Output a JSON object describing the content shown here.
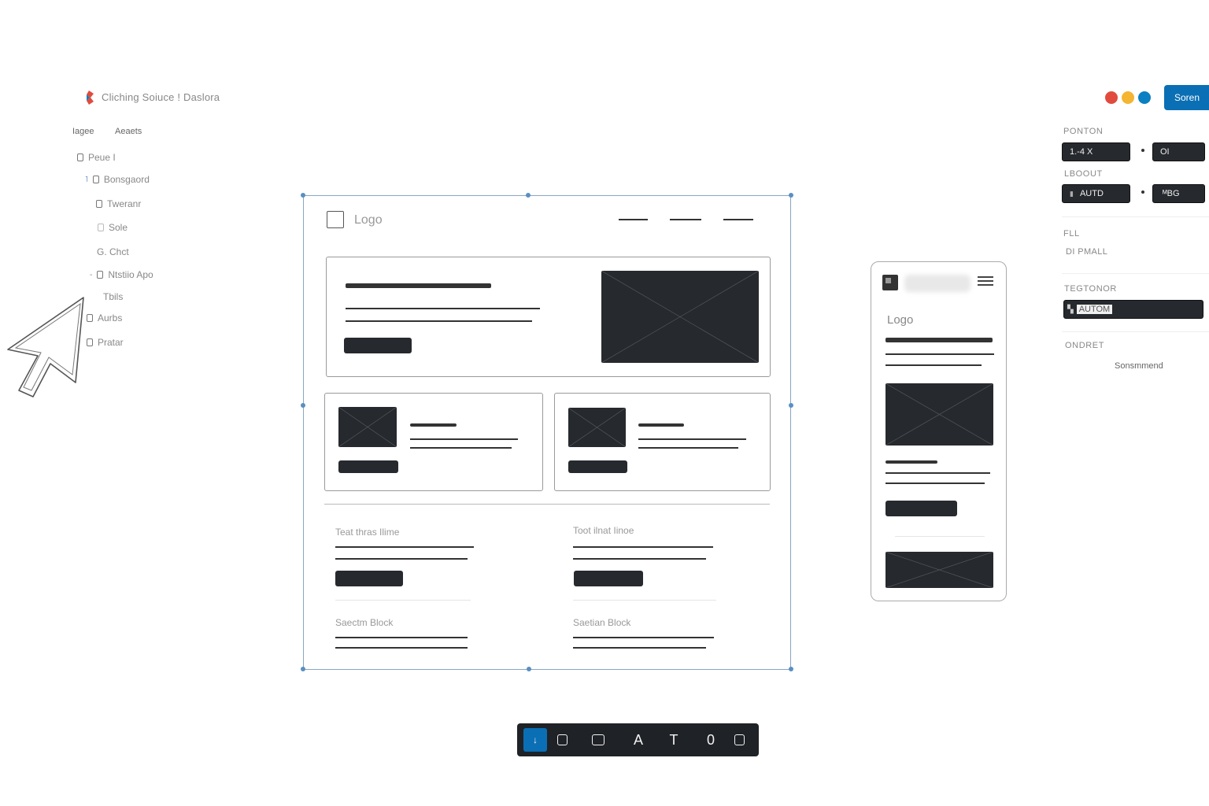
{
  "app": {
    "title": "Cliching Soiuce ! Daslora",
    "share_label": "Soren"
  },
  "colors": {
    "accent": "#0a6fb4",
    "traffic_red": "#e14b3d",
    "traffic_yellow": "#f5b431",
    "traffic_blue": "#0a7fc2",
    "wireframe_fill": "#26292d",
    "selection": "#5a8fc2"
  },
  "sidebar": {
    "tabs": [
      "Iagee",
      "Aeaets"
    ],
    "layers": [
      {
        "label": "Peue I",
        "icon": "frame-icon"
      },
      {
        "label": "Bonsgaord",
        "icon": "frame-icon"
      },
      {
        "label": "Tweranr",
        "icon": "frame-icon"
      },
      {
        "label": "Sole",
        "icon": "frame-icon"
      },
      {
        "label": "G. Chct",
        "icon": "none"
      },
      {
        "label": "Ntstiio Apo",
        "icon": "frame-icon"
      },
      {
        "label": "Tbils",
        "icon": "none"
      },
      {
        "label": "Aurbs",
        "icon": "frame-icon"
      },
      {
        "label": "Pratar",
        "icon": "frame-icon"
      }
    ]
  },
  "canvas": {
    "desktop": {
      "logo_text": "Logo",
      "text_block_1": "Teat thras Ilime",
      "text_block_2": "Toot ilnat Iinoe",
      "section_1": "Saectm Block",
      "section_2": "Saetian Block"
    },
    "mobile": {
      "logo_text": "Logo"
    }
  },
  "properties": {
    "position_label": "PONTON",
    "position_x": "1.-4 X",
    "position_y": "OI",
    "layout_label": "LBOOUT",
    "layout_value": "AUTD",
    "layout_secondary": "ᴹBG",
    "fill_label": "FLL",
    "fill_value": "DI PMALL",
    "text_label": "TEGTONOR",
    "text_value": "AUTOM",
    "export_label": "ONDRET",
    "export_value": "Sonsmmend"
  },
  "toolbar": {
    "tools": [
      {
        "name": "move-tool",
        "glyph": "↓",
        "active": true
      },
      {
        "name": "frame-tool",
        "glyph": "",
        "active": false
      },
      {
        "name": "rectangle-tool",
        "glyph": "",
        "active": false
      },
      {
        "name": "pen-tool",
        "glyph": "A",
        "active": false
      },
      {
        "name": "text-tool",
        "glyph": "T",
        "active": false
      },
      {
        "name": "ellipse-tool",
        "glyph": "0",
        "active": false
      },
      {
        "name": "component-tool",
        "glyph": "",
        "active": false
      }
    ]
  }
}
